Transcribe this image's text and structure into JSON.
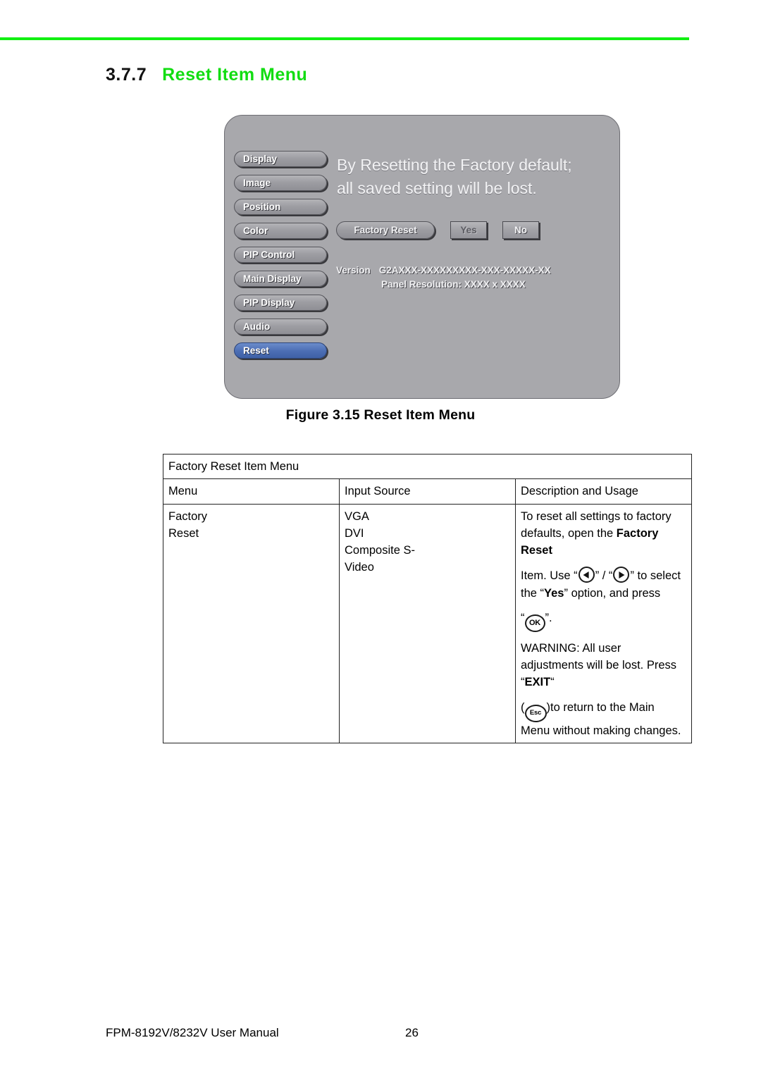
{
  "page": {
    "rule_color": "#12f012",
    "heading_number": "3.7.7",
    "heading_title": "Reset Item Menu",
    "figure_caption": "Figure 3.15 Reset Item Menu"
  },
  "osd": {
    "accent_selected": "#4b6db3",
    "panel_color": "#a8a8ac",
    "menu_items": [
      {
        "label": "Display",
        "selected": false
      },
      {
        "label": "Image",
        "selected": false
      },
      {
        "label": "Position",
        "selected": false
      },
      {
        "label": "Color",
        "selected": false
      },
      {
        "label": "PIP Control",
        "selected": false
      },
      {
        "label": "Main Display",
        "selected": false
      },
      {
        "label": "PIP Display",
        "selected": false
      },
      {
        "label": "Audio",
        "selected": false
      },
      {
        "label": "Reset",
        "selected": true
      }
    ],
    "message_line1": "By Resetting the Factory default;",
    "message_line2": "all saved setting will be lost.",
    "factory_reset_label": "Factory Reset",
    "yes_label": "Yes",
    "no_label": "No",
    "version_label": "Version",
    "version_value": "G2AXXX-XXXXXXXXX-XXX-XXXXX-XX",
    "panel_resolution": "Panel Resolution: XXXX x XXXX"
  },
  "table": {
    "title": "Factory Reset Item Menu",
    "headers": {
      "menu": "Menu",
      "input_source": "Input Source",
      "description": "Description and Usage"
    },
    "row": {
      "menu_lines": [
        "Factory",
        "Reset"
      ],
      "source_lines": [
        "VGA",
        "DVI",
        "Composite S-",
        "Video"
      ],
      "desc_p1_a": "To reset all settings to factory defaults, open the ",
      "desc_p1_bold": "Factory Reset",
      "desc_p2_a": "Item. Use “",
      "desc_p2_b": "” / “",
      "desc_p2_c": "” to select the “",
      "desc_p2_bold": "Yes",
      "desc_p2_d": "” option, and press",
      "desc_p3_a": "“",
      "desc_p3_key": "OK",
      "desc_p3_b": "”.",
      "desc_p4_a": "WARNING: All user adjustments will be lost. Press “",
      "desc_p4_bold": "EXIT",
      "desc_p4_b": "“",
      "desc_p5_a": "(",
      "desc_p5_key": "Esc",
      "desc_p5_b": ")to return to the Main Menu without making changes."
    }
  },
  "footer": {
    "manual": "FPM-8192V/8232V User Manual",
    "page_number": "26"
  }
}
